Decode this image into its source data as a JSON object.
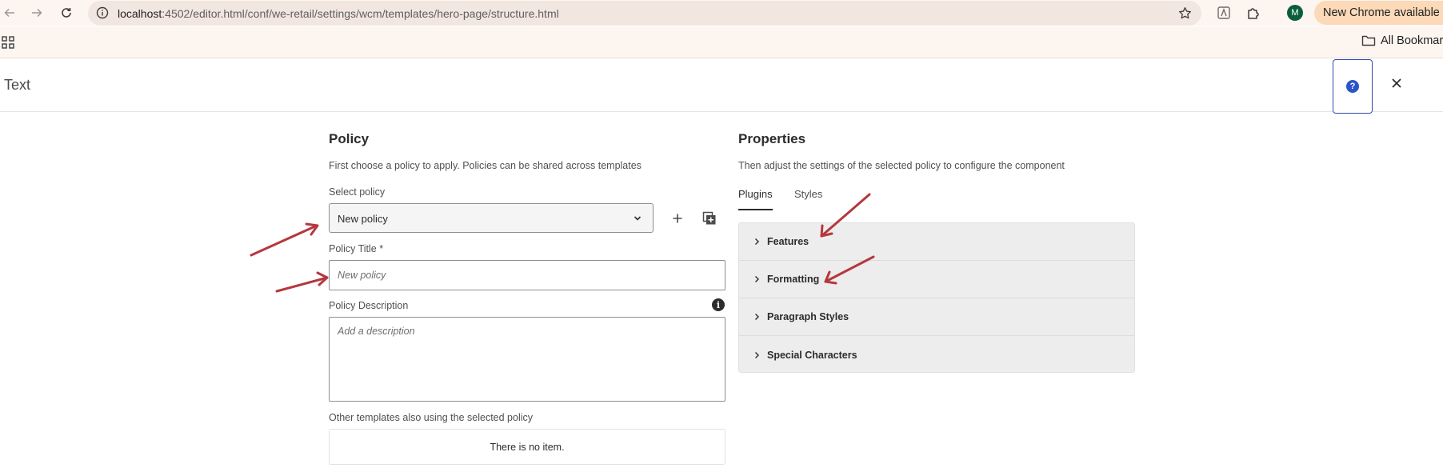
{
  "browser": {
    "url_host": "localhost",
    "url_path": ":4502/editor.html/conf/we-retail/settings/wcm/templates/hero-page/structure.html",
    "profile_initial": "M",
    "update_text": "New Chrome available",
    "bookmarks_label": "All Bookmarks"
  },
  "header": {
    "title": "Text"
  },
  "policy": {
    "title": "Policy",
    "help": "First choose a policy to apply. Policies can be shared across templates",
    "select_label": "Select policy",
    "select_value": "New policy",
    "title_label": "Policy Title *",
    "title_placeholder": "New policy",
    "description_label": "Policy Description",
    "description_placeholder": "Add a description",
    "other_templates_label": "Other templates also using the selected policy",
    "empty_text": "There is no item."
  },
  "properties": {
    "title": "Properties",
    "help": "Then adjust the settings of the selected policy to configure the component",
    "tabs": [
      {
        "label": "Plugins",
        "active": true
      },
      {
        "label": "Styles",
        "active": false
      }
    ],
    "sections": [
      {
        "label": "Features"
      },
      {
        "label": "Formatting"
      },
      {
        "label": "Paragraph Styles"
      },
      {
        "label": "Special Characters"
      }
    ]
  },
  "colors": {
    "annotation_arrow": "#b5383e",
    "help_accent": "#2b55c8",
    "update_pill": "#fcd9b8"
  }
}
